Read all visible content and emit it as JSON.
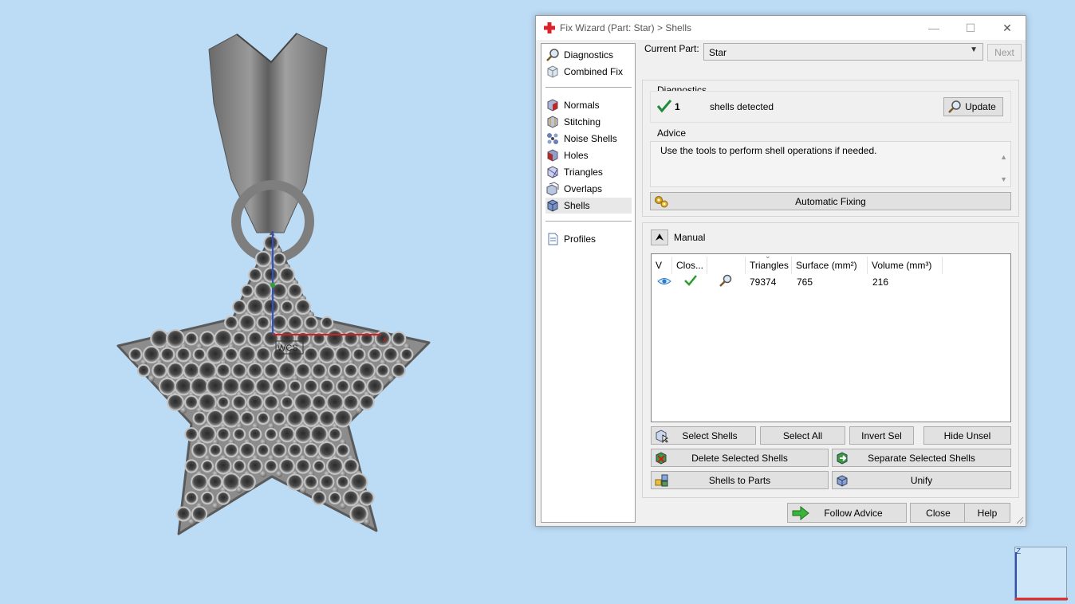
{
  "window": {
    "title": "Fix Wizard (Part: Star) > Shells",
    "minimize": "—",
    "maximize": "☐",
    "close": "✕"
  },
  "nav": {
    "items": [
      {
        "label": "Diagnostics",
        "icon": "magnifier-icon"
      },
      {
        "label": "Combined Fix",
        "icon": "cube-icon"
      },
      {
        "label": "Normals",
        "icon": "normals-cube-icon"
      },
      {
        "label": "Stitching",
        "icon": "stitching-cube-icon"
      },
      {
        "label": "Noise Shells",
        "icon": "noise-shells-icon"
      },
      {
        "label": "Holes",
        "icon": "holes-cube-icon"
      },
      {
        "label": "Triangles",
        "icon": "triangles-cube-icon"
      },
      {
        "label": "Overlaps",
        "icon": "overlaps-cube-icon"
      },
      {
        "label": "Shells",
        "icon": "shells-cube-icon"
      },
      {
        "label": "Profiles",
        "icon": "document-icon"
      }
    ],
    "active": "Shells"
  },
  "current_part": {
    "label": "Current Part:",
    "value": "Star"
  },
  "next_button": "Next",
  "diagnostics": {
    "title": "Diagnostics",
    "count": "1",
    "status_text": "shells detected",
    "update_button": "Update"
  },
  "advice": {
    "title": "Advice",
    "text": "Use the tools to perform shell operations if needed."
  },
  "automatic_fixing_button": "Automatic Fixing",
  "manual": {
    "title": "Manual",
    "collapse_icon": "double-chevron-up-icon"
  },
  "table": {
    "columns": [
      "V",
      "Clos...",
      "",
      "Triangles",
      "Surface (mm²)",
      "Volume (mm³)"
    ],
    "rows": [
      {
        "visible": "eye-icon",
        "closed": "checkmark-icon",
        "tool": "magnifier-icon",
        "triangles": "79374",
        "surface": "765",
        "volume": "216"
      }
    ]
  },
  "buttons": {
    "select_shells": "Select Shells",
    "select_all": "Select All",
    "invert_sel": "Invert Sel",
    "hide_unsel": "Hide Unsel",
    "delete_selected": "Delete Selected Shells",
    "separate_selected": "Separate Selected Shells",
    "shells_to_parts": "Shells to Parts",
    "unify": "Unify",
    "follow_advice": "Follow Advice",
    "close": "Close",
    "help": "Help"
  },
  "viewport": {
    "wcs_label": "WCS",
    "axis_x": "x",
    "axis_z": "Z"
  },
  "colors": {
    "background": "#bcdcf6",
    "model": "#8a8a8a",
    "accent_green": "#2a9d2a"
  }
}
